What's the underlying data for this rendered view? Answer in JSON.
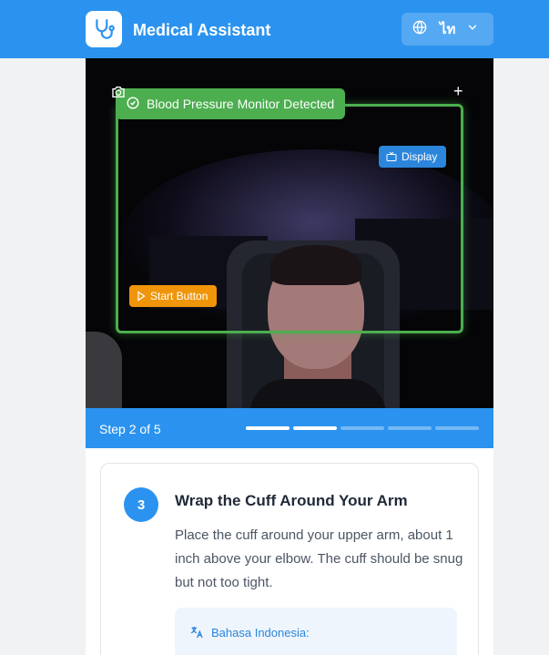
{
  "header": {
    "app_title": "Medical Assistant",
    "logo_icon": "stethoscope-icon",
    "language": {
      "label": "ไท",
      "icon": "globe-icon",
      "chevron": "chevron-down-icon"
    }
  },
  "camera": {
    "detection_label": "Blood Pressure Monitor Detected",
    "tags": {
      "display": "Display",
      "start": "Start Button"
    },
    "icons": [
      "camera-icon",
      "plus-icon",
      "check-circle-icon"
    ]
  },
  "step_bar": {
    "text": "Step 2 of 5",
    "current": 2,
    "total": 5
  },
  "instruction": {
    "number": "3",
    "title": "Wrap the Cuff Around Your Arm",
    "description": "Place the cuff around your upper arm, about 1 inch above your elbow. The cuff should be snug but not too tight.",
    "translation_label": "Bahasa Indonesia:"
  },
  "colors": {
    "primary": "#2b93ef",
    "detection": "#4cae4f",
    "display_tag": "#2b86db",
    "start_tag": "#f0950a"
  }
}
